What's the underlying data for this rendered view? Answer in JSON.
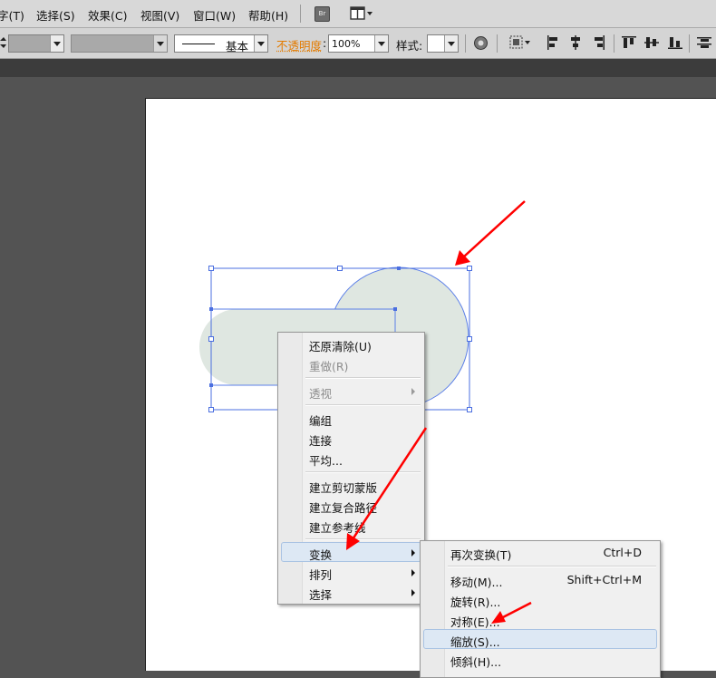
{
  "menubar": {
    "items": [
      "字(T)",
      "选择(S)",
      "效果(C)",
      "视图(V)",
      "窗口(W)",
      "帮助(H)"
    ],
    "bridge_label": "Br"
  },
  "control_bar": {
    "stroke_profile": "基本",
    "opacity_label": "不透明度",
    "opacity_value": "100%",
    "style_label": "样式:"
  },
  "context_menu": {
    "items": [
      {
        "label": "还原清除(U)",
        "disabled": false
      },
      {
        "label": "重做(R)",
        "disabled": true
      },
      {
        "label": "透视",
        "disabled": true,
        "submenu": true
      },
      {
        "label": "编组",
        "disabled": false
      },
      {
        "label": "连接",
        "disabled": false
      },
      {
        "label": "平均...",
        "disabled": false
      },
      {
        "label": "建立剪切蒙版",
        "disabled": false
      },
      {
        "label": "建立复合路径",
        "disabled": false
      },
      {
        "label": "建立参考线",
        "disabled": false
      },
      {
        "label": "变换",
        "disabled": false,
        "submenu": true,
        "highlighted": true
      },
      {
        "label": "排列",
        "disabled": false,
        "submenu": true
      },
      {
        "label": "选择",
        "disabled": false,
        "submenu": true
      }
    ]
  },
  "transform_submenu": {
    "items": [
      {
        "label": "再次变换(T)",
        "shortcut": "Ctrl+D"
      },
      {
        "label": "移动(M)...",
        "shortcut": "Shift+Ctrl+M"
      },
      {
        "label": "旋转(R)...",
        "shortcut": ""
      },
      {
        "label": "对称(E)...",
        "shortcut": ""
      },
      {
        "label": "缩放(S)...",
        "shortcut": "",
        "highlighted": true
      },
      {
        "label": "倾斜(H)...",
        "shortcut": ""
      }
    ]
  },
  "colors": {
    "shape_fill": "#dfe7e1",
    "selection": "#4b6fe0",
    "annotation_arrow": "#ff0000",
    "menu_highlight": "#dde8f4"
  }
}
